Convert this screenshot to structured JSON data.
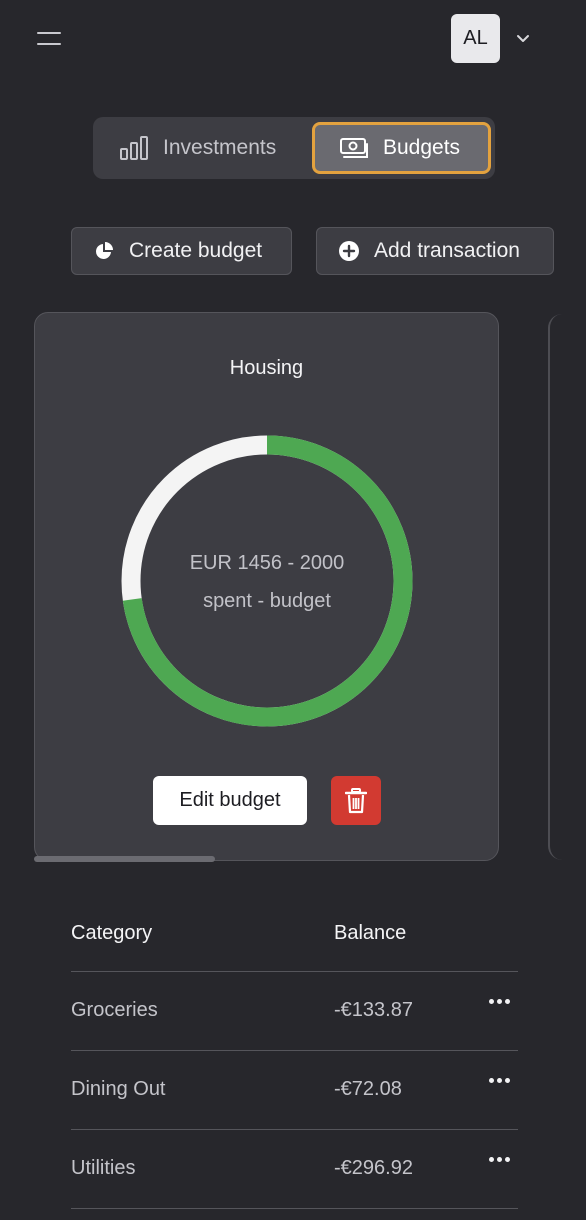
{
  "header": {
    "avatar_initials": "AL"
  },
  "tabs": [
    {
      "label": "Investments",
      "icon": "bar-chart-icon",
      "active": false
    },
    {
      "label": "Budgets",
      "icon": "cash-icon",
      "active": true
    }
  ],
  "actions": {
    "create_budget": "Create budget",
    "add_transaction": "Add transaction"
  },
  "budget_card": {
    "title": "Housing",
    "amount_line": "EUR 1456 - 2000",
    "caption_line": "spent - budget",
    "spent": 1456,
    "budget": 2000,
    "edit_label": "Edit budget",
    "colors": {
      "spent": "#4ea852",
      "remaining": "#f4f4f4",
      "delete": "#d23a31"
    }
  },
  "table": {
    "headers": {
      "category": "Category",
      "balance": "Balance"
    },
    "rows": [
      {
        "category": "Groceries",
        "balance": "-€133.87"
      },
      {
        "category": "Dining Out",
        "balance": "-€72.08"
      },
      {
        "category": "Utilities",
        "balance": "-€296.92"
      }
    ]
  },
  "colors": {
    "background": "#27272c",
    "surface": "#3d3d43",
    "accent": "#e3a23f"
  }
}
